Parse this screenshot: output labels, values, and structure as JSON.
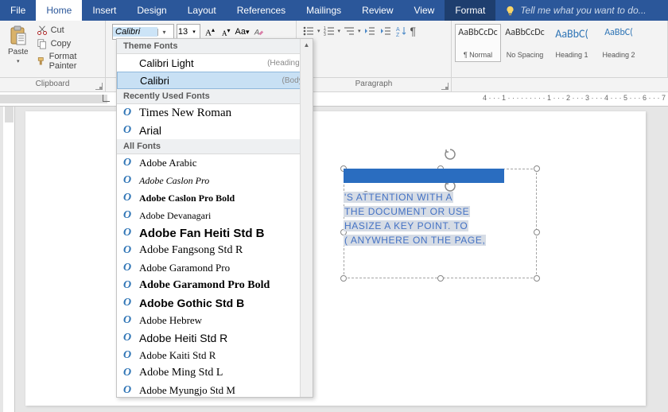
{
  "ribbon": {
    "tabs": [
      "File",
      "Home",
      "Insert",
      "Design",
      "Layout",
      "References",
      "Mailings",
      "Review",
      "View"
    ],
    "active": "Home",
    "context_tab": "Format",
    "tellme_placeholder": "Tell me what you want to do..."
  },
  "clipboard": {
    "paste": "Paste",
    "cut": "Cut",
    "copy": "Copy",
    "format_painter": "Format Painter",
    "group_label": "Clipboard"
  },
  "font": {
    "name": "Calibri",
    "size": "13",
    "grow": "A",
    "shrink": "A",
    "case": "Aa"
  },
  "paragraph": {
    "group_label": "Paragraph"
  },
  "styles": {
    "sample": "AaBbCcDc",
    "sample_h": "AaBbC(",
    "items": [
      {
        "name": "¶ Normal",
        "class": ""
      },
      {
        "name": "No Spacing",
        "class": ""
      },
      {
        "name": "Heading 1",
        "class": "h1"
      },
      {
        "name": "Heading 2",
        "class": "h2"
      }
    ]
  },
  "font_dropdown": {
    "theme_hdr": "Theme Fonts",
    "theme": [
      {
        "name": "Calibri Light",
        "note": "(Headings)"
      },
      {
        "name": "Calibri",
        "note": "(Body)",
        "hover": true
      }
    ],
    "recent_hdr": "Recently Used Fonts",
    "recent": [
      {
        "name": "Times New Roman",
        "css": "font-family:'Times New Roman',serif;font-size:15px;"
      },
      {
        "name": "Arial",
        "css": "font-family:Arial,sans-serif;font-size:14px;"
      }
    ],
    "all_hdr": "All Fonts",
    "all": [
      {
        "name": "Adobe Arabic",
        "css": "font-family:serif;font-size:13px;"
      },
      {
        "name": "Adobe Caslon Pro",
        "css": "font-family:serif;font-style:italic;font-size:12px;"
      },
      {
        "name": "Adobe Caslon Pro Bold",
        "css": "font-family:serif;font-weight:bold;font-size:12px;"
      },
      {
        "name": "Adobe Devanagari",
        "css": "font-family:serif;font-size:12px;"
      },
      {
        "name": "Adobe Fan Heiti Std B",
        "css": "font-family:sans-serif;font-weight:bold;font-size:15px;"
      },
      {
        "name": "Adobe Fangsong Std R",
        "css": "font-family:serif;font-size:14px;"
      },
      {
        "name": "Adobe Garamond Pro",
        "css": "font-family:Garamond,serif;font-size:13px;"
      },
      {
        "name": "Adobe Garamond Pro Bold",
        "css": "font-family:Garamond,serif;font-weight:bold;font-size:14px;"
      },
      {
        "name": "Adobe Gothic Std B",
        "css": "font-family:sans-serif;font-weight:bold;font-size:14px;"
      },
      {
        "name": "Adobe Hebrew",
        "css": "font-family:serif;font-size:13px;"
      },
      {
        "name": "Adobe Heiti Std R",
        "css": "font-family:sans-serif;font-size:14px;"
      },
      {
        "name": "Adobe Kaiti Std R",
        "css": "font-family:serif;font-size:13px;"
      },
      {
        "name": "Adobe Ming Std L",
        "css": "font-family:serif;font-size:14px;"
      },
      {
        "name": "Adobe Myungjo Std M",
        "css": "font-family:serif;font-size:13px;"
      }
    ]
  },
  "textbox": {
    "line1": "'S ATTENTION WITH A",
    "line2": "THE DOCUMENT OR USE",
    "line3": "HASIZE A KEY POINT. TO",
    "line4": "( ANYWHERE ON THE PAGE,"
  },
  "ruler": {
    "left_label": "L",
    "marks": "4 · · · 1 · · · · · · · · · 1 · · · 2 · · · 3 · · · 4 · · · 5 · · · 6 · · · 7"
  }
}
